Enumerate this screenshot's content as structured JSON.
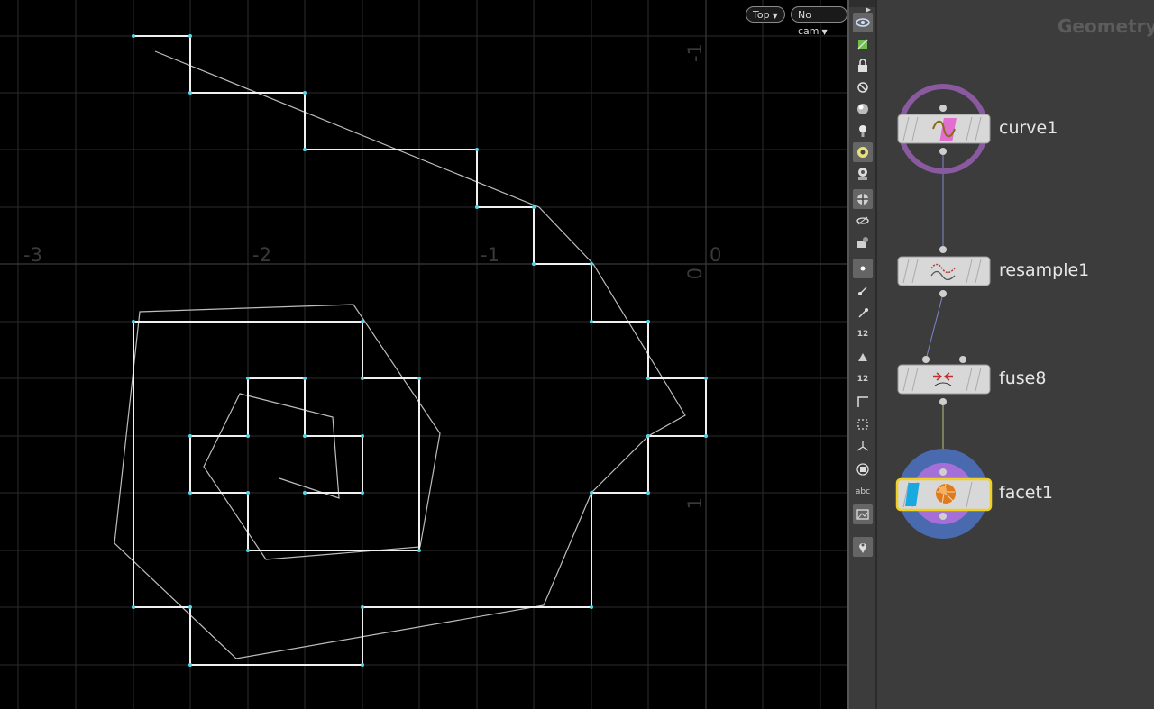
{
  "viewport": {
    "view_menu_label": "Top",
    "camera_menu_label": "No cam",
    "axis_labels": {
      "x": [
        "-3",
        "-2",
        "-1",
        "0"
      ],
      "y": [
        "-1",
        "0",
        "1"
      ]
    }
  },
  "toolbar": {
    "tools": [
      {
        "name": "view-icon",
        "active": true
      },
      {
        "name": "display-options-icon",
        "active": false
      },
      {
        "name": "lock-icon",
        "active": false
      },
      {
        "name": "ghost-icon",
        "active": false
      },
      {
        "name": "shading-icon",
        "active": false
      },
      {
        "name": "light-icon",
        "active": false
      },
      {
        "name": "visibility-icon",
        "active": true
      },
      {
        "name": "template-icon",
        "active": false
      },
      {
        "name": "snapshot-icon",
        "active": true
      },
      {
        "name": "wireframe-icon",
        "active": false
      },
      {
        "name": "paint-icon",
        "active": false
      },
      {
        "name": "points-display-icon",
        "active": true
      },
      {
        "name": "point-normals-icon",
        "active": false
      },
      {
        "name": "prim-normals-icon",
        "active": false
      },
      {
        "name": "point-numbers-icon",
        "active": false,
        "text": "12"
      },
      {
        "name": "vertex-icon",
        "active": false
      },
      {
        "name": "prim-numbers-icon",
        "active": false,
        "text": "12"
      },
      {
        "name": "corner-icon",
        "active": false
      },
      {
        "name": "bounds-icon",
        "active": false
      },
      {
        "name": "axes-icon",
        "active": false
      },
      {
        "name": "hull-icon",
        "active": false
      },
      {
        "name": "text-display-icon",
        "active": false,
        "text": "abc"
      },
      {
        "name": "background-image-icon",
        "active": true
      },
      {
        "name": "location-pin-icon",
        "active": true
      }
    ]
  },
  "network": {
    "title": "Geometry",
    "nodes": [
      {
        "name": "curve1",
        "icon": "curve-icon"
      },
      {
        "name": "resample1",
        "icon": "resample-icon"
      },
      {
        "name": "fuse8",
        "icon": "fuse-icon"
      },
      {
        "name": "facet1",
        "icon": "facet-icon"
      }
    ]
  }
}
